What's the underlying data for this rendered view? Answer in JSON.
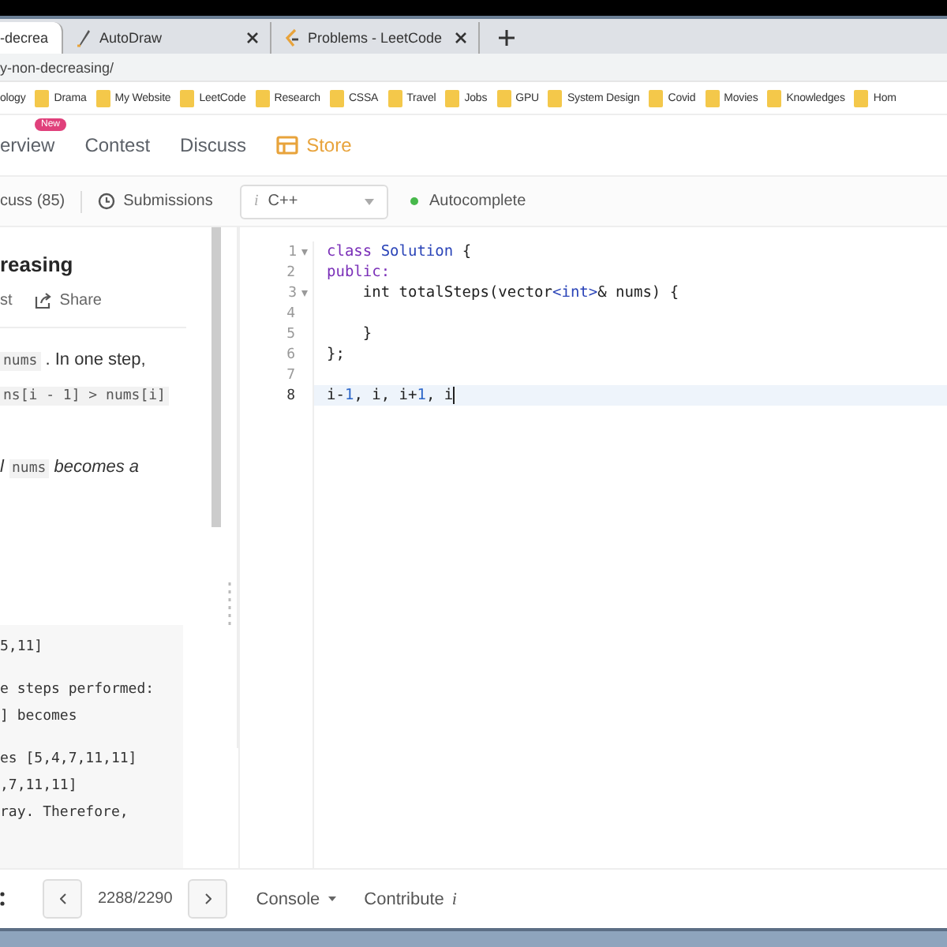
{
  "browser": {
    "tabs": [
      {
        "title": "-decrea",
        "selected": true
      },
      {
        "title": "AutoDraw",
        "selected": false
      },
      {
        "title": "Problems - LeetCode",
        "selected": false
      }
    ],
    "address": "y-non-decreasing/",
    "bookmarks": [
      "ology",
      "Drama",
      "My Website",
      "LeetCode",
      "Research",
      "CSSA",
      "Travel",
      "Jobs",
      "GPU",
      "System Design",
      "Covid",
      "Movies",
      "Knowledges",
      "Hom"
    ]
  },
  "nav": [
    {
      "label": "erview",
      "badge": "New",
      "kind": "plain"
    },
    {
      "label": "Contest",
      "kind": "plain"
    },
    {
      "label": "Discuss",
      "kind": "plain"
    },
    {
      "label": "Store",
      "kind": "store"
    }
  ],
  "subtabs": [
    "cuss (85)",
    "Submissions"
  ],
  "language": {
    "hint": "i",
    "value": "C++"
  },
  "autocomplete": {
    "label": "Autocomplete",
    "on": true
  },
  "problem": {
    "title": "reasing",
    "actions": [
      "st",
      "Share"
    ],
    "lines": [
      [
        {
          "t": "nums",
          "kind": "code"
        },
        {
          "t": " . In one step,",
          "kind": "text"
        }
      ],
      [
        {
          "t": "ns[i - 1] > nums[i]",
          "kind": "code"
        }
      ],
      [
        {
          "t": "l ",
          "kind": "italic"
        },
        {
          "t": "nums",
          "kind": "code"
        },
        {
          "t": " becomes a",
          "kind": "italic"
        }
      ]
    ],
    "example": [
      [
        "5,11]"
      ],
      [
        "e steps performed:",
        "] becomes"
      ],
      [
        "es [5,4,7,11,11]",
        ",7,11,11]",
        "ray. Therefore,"
      ]
    ]
  },
  "editor": {
    "lines": [
      {
        "number": "1",
        "fold": true,
        "current": false,
        "tokens": [
          {
            "t": "class",
            "kind": "keyword"
          },
          {
            "t": " Solution",
            "kind": "type"
          },
          {
            "t": " {",
            "kind": "plain"
          }
        ]
      },
      {
        "number": "2",
        "fold": false,
        "current": false,
        "tokens": [
          {
            "t": "public:",
            "kind": "keyword"
          }
        ]
      },
      {
        "number": "3",
        "fold": true,
        "current": false,
        "tokens": [
          {
            "t": "    int totalSteps(vector",
            "kind": "plain"
          },
          {
            "t": "<int>",
            "kind": "type"
          },
          {
            "t": "& nums) {",
            "kind": "plain"
          }
        ]
      },
      {
        "number": "4",
        "fold": false,
        "current": false
      },
      {
        "number": "5",
        "fold": false,
        "current": false,
        "tokens": [
          {
            "t": "    }",
            "kind": "plain"
          }
        ]
      },
      {
        "number": "6",
        "fold": false,
        "current": false,
        "tokens": [
          {
            "t": "};",
            "kind": "plain"
          }
        ]
      },
      {
        "number": "7",
        "fold": false,
        "current": false
      },
      {
        "number": "8",
        "fold": false,
        "current": true,
        "tokens": [
          {
            "t": "i-",
            "kind": "plain"
          },
          {
            "t": "1",
            "kind": "number"
          },
          {
            "t": ", i, i+",
            "kind": "plain"
          },
          {
            "t": "1",
            "kind": "number"
          },
          {
            "t": ", i",
            "kind": "plain"
          }
        ]
      }
    ]
  },
  "footer": {
    "page": "2288/2290",
    "console": "Console",
    "contribute": "Contribute",
    "contribute_icon": "i"
  }
}
